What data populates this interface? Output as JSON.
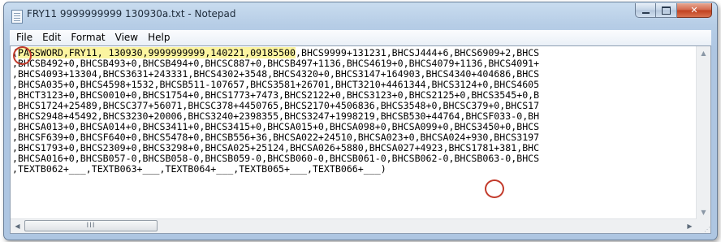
{
  "window": {
    "title": "FRY11 9999999999 130930a.txt - Notepad",
    "icon": "notepad-icon",
    "buttons": {
      "minimize": "minimize-icon",
      "maximize": "maximize-icon",
      "close": "close-icon",
      "close_glyph": "✕"
    }
  },
  "menu": [
    "File",
    "Edit",
    "Format",
    "View",
    "Help"
  ],
  "editor": {
    "highlighted": "PASSWORD,FRY11, 130930,9999999999,140221,09185500",
    "lines": [
      ",BHCS9999+131231,BHCSJ444+6,BHCS6909+2,BHCS",
      ",BHCSB492+0,BHCSB493+0,BHCSB494+0,BHCSC887+0,BHCSB497+1136,BHCS4619+0,BHCS4079+1136,BHCS4091+",
      ",BHCS4093+13304,BHCS3631+243331,BHCS4302+3548,BHCS4320+0,BHCS3147+164903,BHCS4340+404686,BHCS",
      ",BHCSA035+0,BHCS4598+1532,BHCSB511-107657,BHCS3581+26701,BHCT3210+4461344,BHCS3124+0,BHCS4605",
      ",BHCT3123+0,BHCS0010+0,BHCS1754+0,BHCS1773+7473,BHCS2122+0,BHCS3123+0,BHCS2125+0,BHCS3545+0,B",
      ",BHCS1724+25489,BHCSC377+56071,BHCSC378+4450765,BHCS2170+4506836,BHCS3548+0,BHCSC379+0,BHCS17",
      ",BHCS2948+45492,BHCS3230+20006,BHCS3240+2398355,BHCS3247+1998219,BHCSB530+44764,BHCSF033-0,BH",
      ",BHCSA013+0,BHCSA014+0,BHCS3411+0,BHCS3415+0,BHCSA015+0,BHCSA098+0,BHCSA099+0,BHCS3450+0,BHCS",
      ",BHCSF639+0,BHCSF640+0,BHCS5478+0,BHCSB556+36,BHCSA022+24510,BHCSA023+0,BHCSA024+930,BHCS3197",
      ",BHCS1793+0,BHCS2309+0,BHCS3298+0,BHCSA025+25124,BHCSA026+5880,BHCSA027+4923,BHCS1781+381,BHC",
      ",BHCSA016+0,BHCSB057-0,BHCSB058-0,BHCSB059-0,BHCSB060-0,BHCSB061-0,BHCSB062-0,BHCSB063-0,BHCS",
      ",TEXTB062+___,TEXTB063+___,TEXTB064+___,TEXTB065+___,TEXTB066+___)"
    ]
  },
  "scrollbars": {
    "up_glyph": "▲",
    "down_glyph": "▼",
    "left_glyph": "◀",
    "right_glyph": "▶",
    "thumb_grip": "III",
    "size_grip": "⋰"
  },
  "annotations": {
    "color": "#c23a2b"
  },
  "colors": {
    "highlight": "#fbf4a0",
    "close_button": "#c7462a",
    "frame": "#b6cde6"
  }
}
